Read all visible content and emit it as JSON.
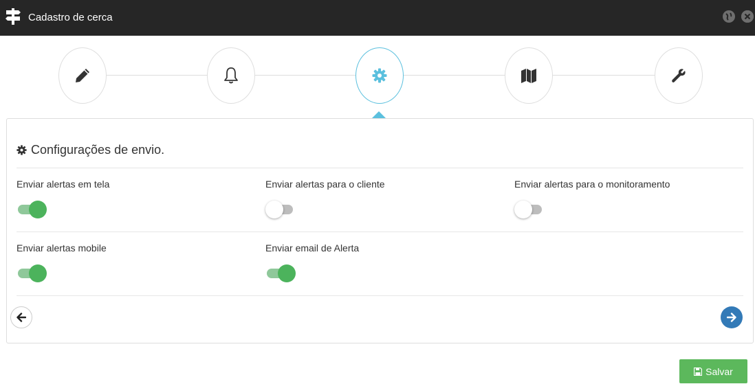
{
  "window": {
    "title": "Cadastro de cerca",
    "icons": {
      "app": "signpost-icon",
      "globe": "globe-icon",
      "close": "close-icon"
    }
  },
  "steps": [
    {
      "icon": "pencil-icon",
      "active": false
    },
    {
      "icon": "bell-icon",
      "active": false
    },
    {
      "icon": "gear-icon",
      "active": true
    },
    {
      "icon": "map-icon",
      "active": false
    },
    {
      "icon": "wrench-icon",
      "active": false
    }
  ],
  "section": {
    "title": "Configurações de envio.",
    "icon": "gear-icon"
  },
  "fields": {
    "alerts_screen": {
      "label": "Enviar alertas em tela",
      "enabled": true
    },
    "alerts_client": {
      "label": "Enviar alertas para o cliente",
      "enabled": false
    },
    "alerts_monitoring": {
      "label": "Enviar alertas para o monitoramento",
      "enabled": false
    },
    "alerts_mobile": {
      "label": "Enviar alertas mobile",
      "enabled": true
    },
    "alert_email": {
      "label": "Enviar email de Alerta",
      "enabled": true
    }
  },
  "navigation": {
    "prev_icon": "arrow-left-icon",
    "next_icon": "arrow-right-icon"
  },
  "actions": {
    "save_label": "Salvar",
    "save_icon": "floppy-disk-icon"
  },
  "colors": {
    "titlebar": "#262626",
    "active_step": "#5bc0de",
    "toggle_on": "#4cb35c",
    "next_button": "#337ab7",
    "save_button": "#5cb85c"
  }
}
